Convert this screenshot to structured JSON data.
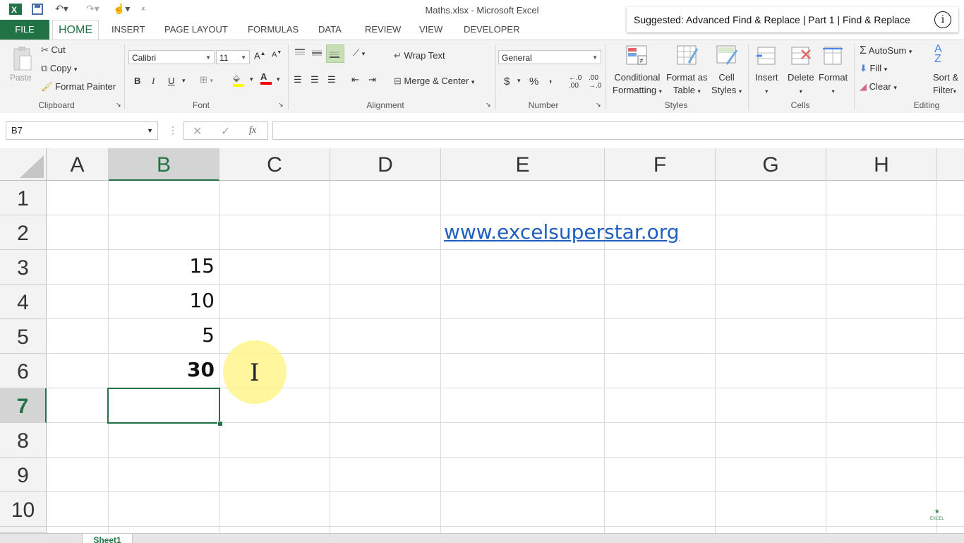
{
  "window": {
    "title": "Maths.xlsx - Microsoft Excel"
  },
  "suggestion": {
    "text": "Suggested: Advanced Find & Replace | Part 1 | Find & Replace",
    "info_icon": "i"
  },
  "tabs": [
    "FILE",
    "HOME",
    "INSERT",
    "PAGE LAYOUT",
    "FORMULAS",
    "DATA",
    "REVIEW",
    "VIEW",
    "DEVELOPER"
  ],
  "ribbon": {
    "clipboard": {
      "paste": "Paste",
      "cut": "Cut",
      "copy": "Copy",
      "format_painter": "Format Painter",
      "label": "Clipboard"
    },
    "font": {
      "family": "Calibri",
      "size": "11",
      "label": "Font",
      "bold": "B",
      "italic": "I",
      "underline": "U"
    },
    "alignment": {
      "wrap_text": "Wrap Text",
      "merge_center": "Merge & Center",
      "label": "Alignment"
    },
    "number": {
      "format": "General",
      "label": "Number",
      "currency": "$",
      "percent": "%",
      "comma": ","
    },
    "styles": {
      "conditional_1": "Conditional",
      "conditional_2": "Formatting",
      "format_table_1": "Format as",
      "format_table_2": "Table",
      "cell_styles_1": "Cell",
      "cell_styles_2": "Styles",
      "label": "Styles"
    },
    "cells": {
      "insert": "Insert",
      "delete": "Delete",
      "format": "Format",
      "label": "Cells"
    },
    "editing": {
      "autosum": "AutoSum",
      "fill": "Fill",
      "clear": "Clear",
      "sort_1": "Sort &",
      "sort_2": "Filter",
      "label": "Editing"
    }
  },
  "formula_bar": {
    "name_box": "B7",
    "fx": "fx",
    "formula": ""
  },
  "grid": {
    "columns": [
      "A",
      "B",
      "C",
      "D",
      "E",
      "F",
      "G",
      "H"
    ],
    "rows": [
      "1",
      "2",
      "3",
      "4",
      "5",
      "6",
      "7",
      "8",
      "9",
      "10"
    ],
    "selected_cell": "B7",
    "cells": {
      "B3": "15",
      "B4": "10",
      "B5": "5",
      "B6": "30",
      "E2": "www.excelsuperstar.org"
    }
  },
  "sheets": {
    "active": "Sheet1"
  },
  "colors": {
    "excel_green": "#217346",
    "link": "#1f5fbf",
    "highlight": "#fff58c"
  }
}
